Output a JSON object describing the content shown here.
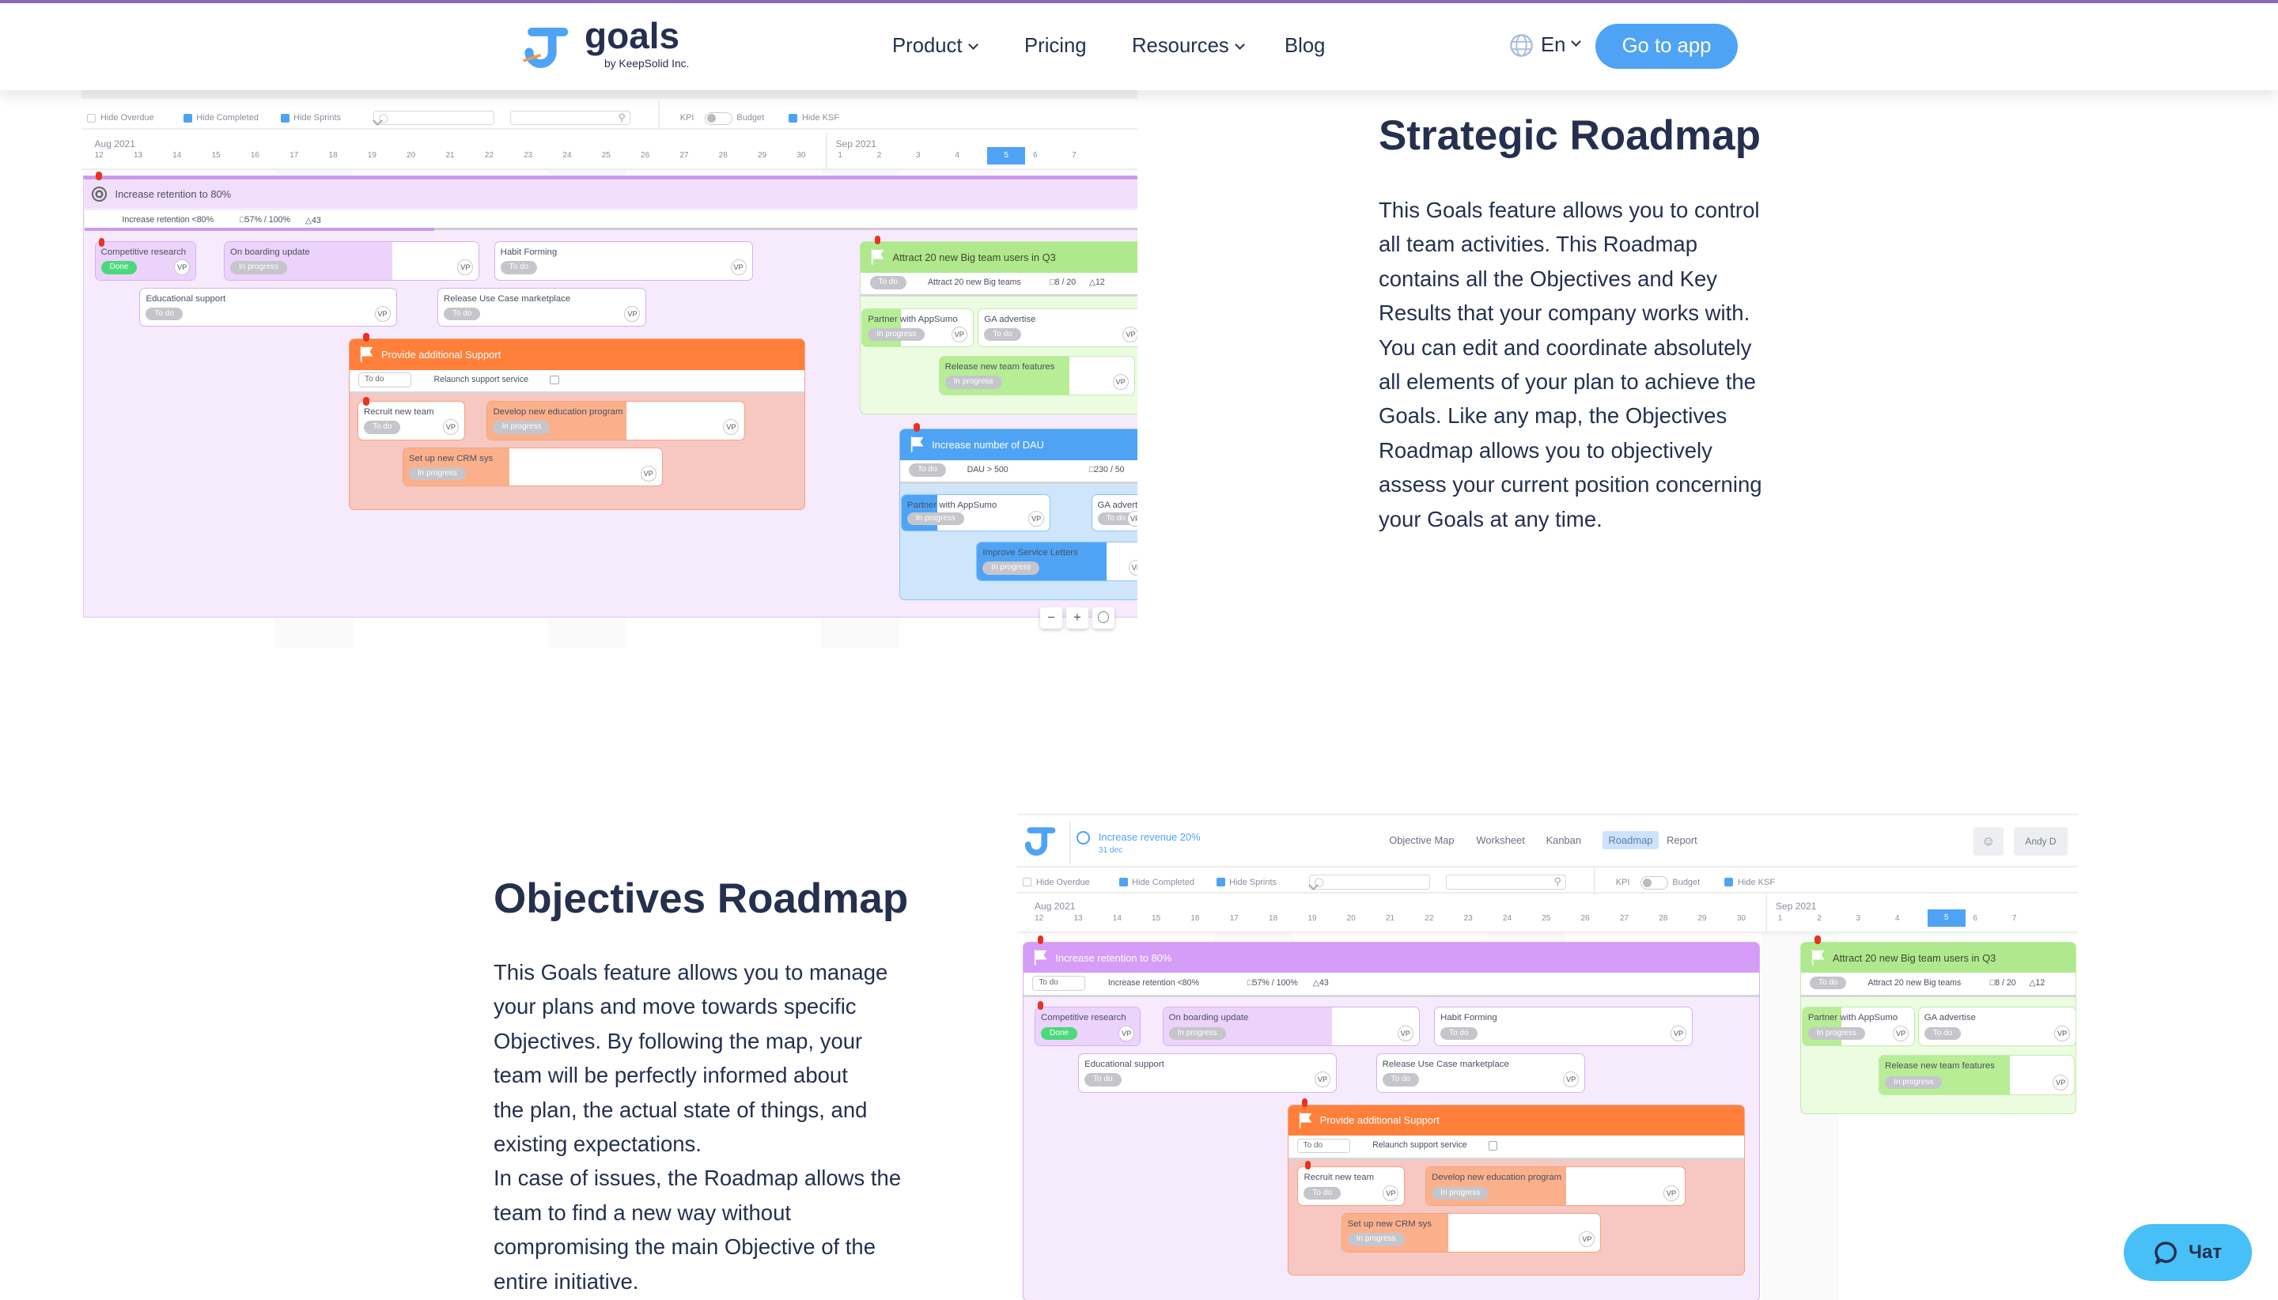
{
  "nav": {
    "logo_text": "goals",
    "logo_sub": "by KeepSolid Inc.",
    "items": [
      {
        "label": "Product",
        "dropdown": true
      },
      {
        "label": "Pricing"
      },
      {
        "label": "Resources",
        "dropdown": true
      },
      {
        "label": "Blog"
      }
    ],
    "language": "En",
    "cta": "Go to app",
    "accent": "#4ea3f5"
  },
  "section1": {
    "title": "Strategic Roadmap",
    "lines": [
      "This Goals feature allows you to control",
      "all team activities. This Roadmap",
      "contains all the Objectives and Key",
      "Results that your company works with.",
      "You can edit and coordinate absolutely",
      "all elements of your plan to achieve the",
      "Goals. Like any map, the Objectives",
      "Roadmap allows you to objectively",
      "assess your current position concerning",
      "your Goals at any time."
    ]
  },
  "section2": {
    "title": "Objectives Roadmap",
    "lines": [
      "This Goals feature allows you to manage",
      "your plans and move towards specific",
      "Objectives. By following the map, your",
      "team will be perfectly informed about",
      "the plan, the actual state of things, and",
      "existing expectations.",
      "In case of issues, the Roadmap allows the",
      "team to find a new way without",
      "compromising the main Objective of the",
      "entire initiative."
    ]
  },
  "toolbar": {
    "hide_overdue": "Hide Overdue",
    "hide_overdue_checked": false,
    "hide_completed": "Hide Completed",
    "hide_completed_checked": true,
    "hide_sprints": "Hide Sprints",
    "hide_sprints_checked": true,
    "kpi": "KPI",
    "budget": "Budget",
    "hide_ksf": "Hide KSF",
    "hide_ksf_checked": true
  },
  "timeline": {
    "months": [
      "Aug 2021",
      "Sep 2021"
    ],
    "aug_days": [
      "12",
      "13",
      "14",
      "15",
      "16",
      "17",
      "18",
      "19",
      "20",
      "21",
      "22",
      "23",
      "24",
      "25",
      "26",
      "27",
      "28",
      "29",
      "30"
    ],
    "sep_days": [
      "1",
      "2",
      "3",
      "4",
      "5",
      "6",
      "7"
    ],
    "today": "5"
  },
  "app_header": {
    "objective": "Increase revenue 20%",
    "due": "31 dec",
    "tabs": [
      "Objective Map",
      "Worksheet",
      "Kanban",
      "Roadmap",
      "Report"
    ],
    "active_tab": "Roadmap",
    "user": "Andy D"
  },
  "objective": {
    "title": "Increase retention to 80%",
    "kr": "Increase retention <80%",
    "progress": "57% / 100%",
    "count": "43",
    "bar_fill_pct": 33
  },
  "cards": {
    "cr": {
      "title": "Competitive research",
      "status": "Done",
      "fill_pct": 100
    },
    "ob": {
      "title": "On boarding update",
      "status": "In progress",
      "fill_pct": 66
    },
    "hf": {
      "title": "Habit Forming",
      "status": "To do",
      "fill_pct": 0
    },
    "es": {
      "title": "Educational support",
      "status": "To do",
      "fill_pct": 0
    },
    "ru": {
      "title": "Release Use Case marketplace",
      "status": "To do",
      "fill_pct": 0
    },
    "rn": {
      "title": "Recruit new team",
      "status": "To do",
      "fill_pct": 0
    },
    "dn": {
      "title": "Develop new education program",
      "status": "In progress",
      "fill_pct": 54
    },
    "cs": {
      "title": "Set up new CRM sys",
      "status": "In progress",
      "fill_pct": 41
    },
    "pa": {
      "title": "Partner with AppSumo",
      "status": "In progress",
      "fill_pct": 35
    },
    "ga": {
      "title": "GA advertise",
      "status": "To do",
      "fill_pct": 0
    },
    "rt": {
      "title": "Release new team features",
      "status": "In progress",
      "fill_pct": 67
    },
    "pa2": {
      "title": "Partner with AppSumo",
      "status": "In progress",
      "fill_pct": 24
    },
    "ga2": {
      "title": "GA advertise",
      "status": "To do",
      "fill_pct": 0
    },
    "is": {
      "title": "Improve Service Letters",
      "status": "In progress",
      "fill_pct": 75
    }
  },
  "owner": "VP",
  "groups": {
    "support": {
      "title": "Provide additional Support",
      "status": "To do",
      "kr": "Relaunch support service",
      "color": "#ff7f3b"
    },
    "attract": {
      "title": "Attract 20 new Big team users in Q3",
      "status": "To do",
      "kr": "Attract 20 new Big teams",
      "metric": "8 / 20",
      "count": "12",
      "color": "#b0e88e"
    },
    "dau": {
      "title": "Increase number of DAU",
      "status": "To do",
      "kr": "DAU > 500",
      "metric": "230 / 50",
      "color": "#4ea3f5"
    },
    "retention": {
      "title": "Increase retention to 80%",
      "status": "To do",
      "kr": "Increase retention <80%",
      "metric": "57% / 100%",
      "count": "43",
      "color": "#d59cf8"
    }
  },
  "zoom_controls": {
    "minus": "−",
    "plus": "+"
  },
  "chat": {
    "label": "Чат",
    "color": "#46c0f6"
  }
}
